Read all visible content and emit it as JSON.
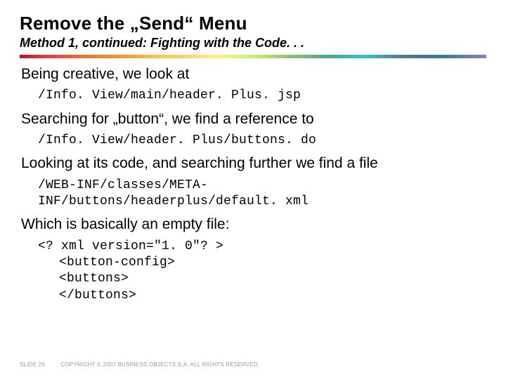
{
  "title": "Remove the „Send“ Menu",
  "subtitle": "Method 1, continued: Fighting with the Code. . .",
  "body": {
    "p1": "Being creative, we look at",
    "code1": "/Info. View/main/header. Plus. jsp",
    "p2": "Searching for „button“, we find a reference to",
    "code2": "/Info. View/header. Plus/buttons. do",
    "p3": "Looking at its code, and searching further we find a file",
    "code3a": "/WEB-INF/classes/META-",
    "code3b": "INF/buttons/headerplus/default. xml",
    "p4": "Which is basically an empty file:",
    "code4a": "<? xml version=\"1. 0\"? >",
    "code4b": "<button-config>",
    "code4c": "<buttons>",
    "code4d": "</buttons>"
  },
  "footer": {
    "slide": "SLIDE 29",
    "copyright": "COPYRIGHT © 2007 BUSINESS OBJECTS S.A.  ALL RIGHTS RESERVED."
  }
}
